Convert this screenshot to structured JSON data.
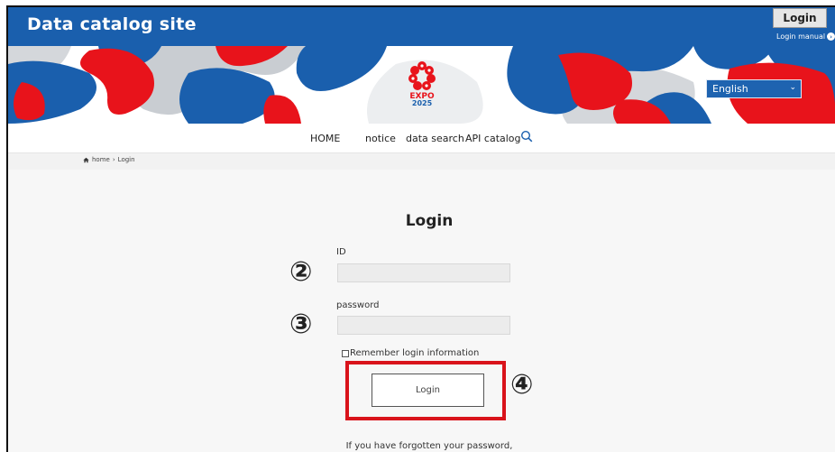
{
  "header": {
    "site_title": "Data catalog site",
    "login_button": "Login",
    "login_manual": "Login manual"
  },
  "banner": {
    "language_selected": "English",
    "logo_alt": "EXPO 2025",
    "colors": {
      "blue": "#1a5fad",
      "red": "#e8131b",
      "gray": "#c8ccd0"
    }
  },
  "nav": {
    "items": [
      "HOME",
      "notice",
      "data search",
      "API catalog"
    ]
  },
  "breadcrumb": {
    "home": "home",
    "separator": "›",
    "current": "Login"
  },
  "login": {
    "title": "Login",
    "id_label": "ID",
    "password_label": "password",
    "remember_label": "Remember login information",
    "submit_label": "Login",
    "forgot_text": "If you have forgotten your password,"
  },
  "annotations": {
    "step_2": "②",
    "step_3": "③",
    "step_4": "④",
    "highlight_color": "#d9131b"
  }
}
